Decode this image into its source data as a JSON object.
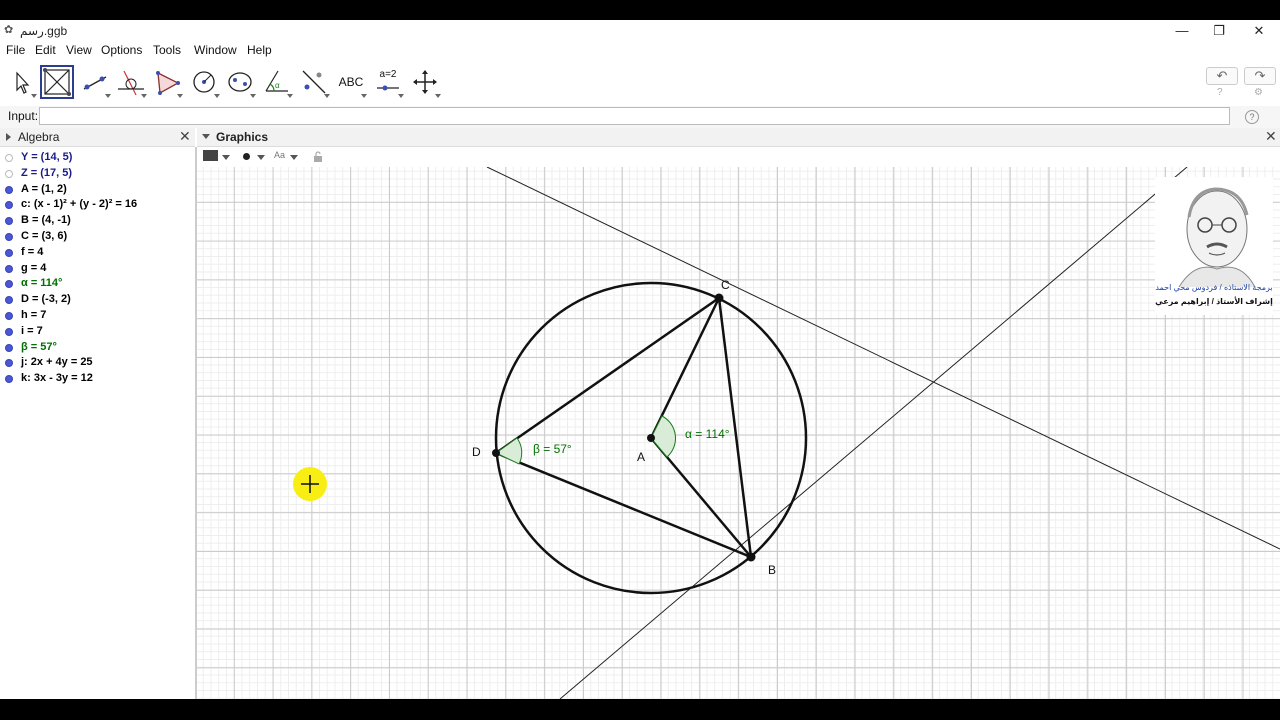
{
  "window": {
    "title": "رسم.ggb",
    "controls": {
      "minimize": "—",
      "maximize": "❐",
      "close": "✕"
    }
  },
  "menu": [
    "File",
    "Edit",
    "View",
    "Options",
    "Tools",
    "Window",
    "Help"
  ],
  "toolbar": {
    "tools": [
      {
        "name": "move-tool",
        "icon": "arrow-pointer-icon"
      },
      {
        "name": "perpendicular-bisector-tool",
        "icon": "square-diagonal-icon",
        "selected": true
      },
      {
        "name": "line-tool",
        "icon": "line-through-points-icon"
      },
      {
        "name": "perpendicular-line-tool",
        "icon": "perpendicular-icon"
      },
      {
        "name": "polygon-tool",
        "icon": "polygon-icon"
      },
      {
        "name": "circle-tool",
        "icon": "circle-center-icon"
      },
      {
        "name": "ellipse-tool",
        "icon": "ellipse-icon"
      },
      {
        "name": "angle-tool",
        "icon": "angle-icon"
      },
      {
        "name": "reflect-tool",
        "icon": "reflect-line-icon"
      },
      {
        "name": "text-tool",
        "label": "ABC"
      },
      {
        "name": "slider-tool",
        "label": "a=2"
      },
      {
        "name": "move-graphics-tool",
        "icon": "move-arrows-icon"
      }
    ],
    "undo": "↶",
    "redo": "↷"
  },
  "input": {
    "label": "Input:",
    "value": ""
  },
  "algebra": {
    "title": "Algebra",
    "items": [
      {
        "text": "Y = (14, 5)",
        "color": "#1a1a8c",
        "visible": false
      },
      {
        "text": "Z = (17, 5)",
        "color": "#1a1a8c",
        "visible": false
      },
      {
        "text": "A = (1, 2)",
        "color": "#000000",
        "visible": true
      },
      {
        "text": "c: (x - 1)² + (y - 2)² = 16",
        "color": "#000000",
        "visible": true
      },
      {
        "text": "B = (4, -1)",
        "color": "#000000",
        "visible": true
      },
      {
        "text": "C = (3, 6)",
        "color": "#000000",
        "visible": true
      },
      {
        "text": "f = 4",
        "color": "#000000",
        "visible": true
      },
      {
        "text": "g = 4",
        "color": "#000000",
        "visible": true
      },
      {
        "text": "α = 114°",
        "color": "#007000",
        "visible": true
      },
      {
        "text": "D = (-3, 2)",
        "color": "#000000",
        "visible": true
      },
      {
        "text": "h = 7",
        "color": "#000000",
        "visible": true
      },
      {
        "text": "i = 7",
        "color": "#000000",
        "visible": true
      },
      {
        "text": "β = 57°",
        "color": "#007000",
        "visible": true
      },
      {
        "text": "j: 2x + 4y = 25",
        "color": "#000000",
        "visible": true
      },
      {
        "text": "k: 3x - 3y = 12",
        "color": "#000000",
        "visible": true
      }
    ]
  },
  "graphics": {
    "title": "Graphics",
    "labels": {
      "A": "A",
      "B": "B",
      "C": "C",
      "D": "D",
      "alpha": "α = 114°",
      "beta": "β = 57°"
    },
    "angle_color": "#007000",
    "portrait_caption_1": "برمجة الاستاذه / فردوس محي احمد",
    "portrait_caption_2": "إشراف الأستاذ / إبراهيم مرعي"
  }
}
